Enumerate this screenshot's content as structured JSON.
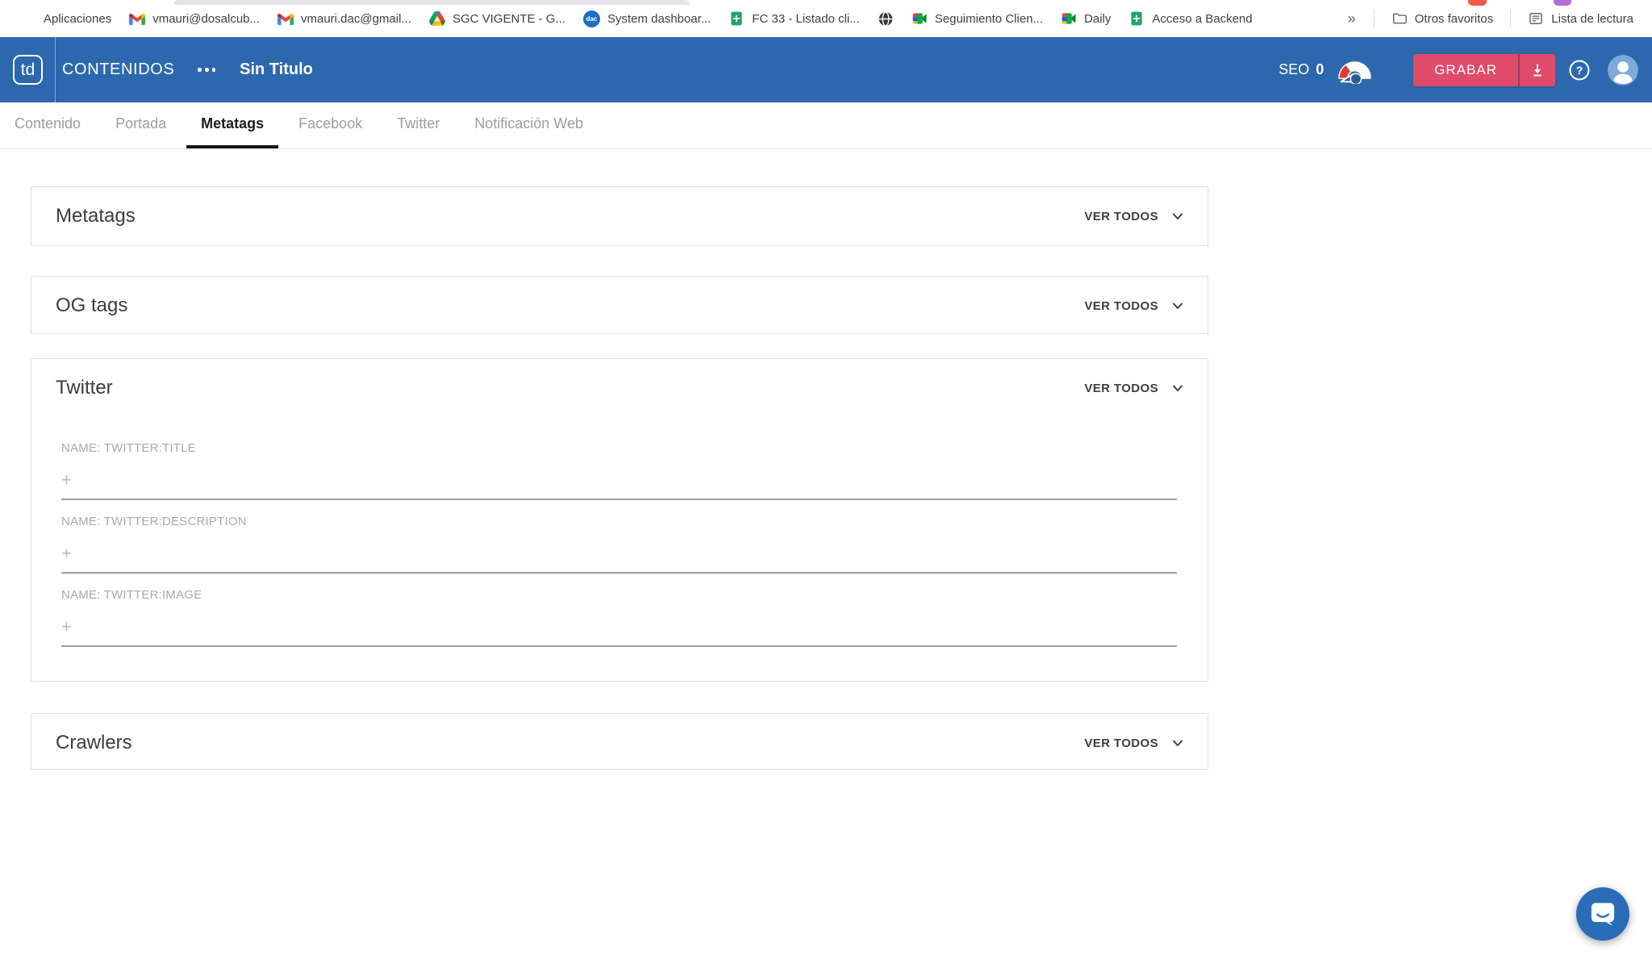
{
  "browser": {
    "bookmarks": [
      {
        "label": "Aplicaciones",
        "icon": "apps-grid"
      },
      {
        "label": "vmauri@dosalcub...",
        "icon": "gmail"
      },
      {
        "label": "vmauri.dac@gmail...",
        "icon": "gmail"
      },
      {
        "label": "SGC VIGENTE - G...",
        "icon": "drive"
      },
      {
        "label": "System dashboar...",
        "icon": "dac"
      },
      {
        "label": "FC 33 - Listado cli...",
        "icon": "sheets"
      },
      {
        "label": "",
        "icon": "globe"
      },
      {
        "label": "Seguimiento Clien...",
        "icon": "meet"
      },
      {
        "label": "Daily",
        "icon": "meet"
      },
      {
        "label": "Acceso a Backend",
        "icon": "sheets"
      }
    ],
    "overflow_chevron": "»",
    "other_favorites": "Otros favoritos",
    "reading_list": "Lista de lectura"
  },
  "app_header": {
    "logo": "td",
    "section": "CONTENIDOS",
    "page_title": "Sin Titulo",
    "seo_label": "SEO",
    "seo_value": "0",
    "save_label": "GRABAR"
  },
  "tabs": [
    {
      "label": "Contenido",
      "active": false
    },
    {
      "label": "Portada",
      "active": false
    },
    {
      "label": "Metatags",
      "active": true
    },
    {
      "label": "Facebook",
      "active": false
    },
    {
      "label": "Twitter",
      "active": false
    },
    {
      "label": "Notificación Web",
      "active": false
    }
  ],
  "sections": [
    {
      "title": "Metatags",
      "action": "VER TODOS",
      "expanded": false
    },
    {
      "title": "OG tags",
      "action": "VER TODOS",
      "expanded": false
    },
    {
      "title": "Twitter",
      "action": "VER TODOS",
      "expanded": true,
      "fields": [
        {
          "label": "NAME: TWITTER:TITLE",
          "add": "+",
          "value": ""
        },
        {
          "label": "NAME: TWITTER:DESCRIPTION",
          "add": "+",
          "value": ""
        },
        {
          "label": "NAME: TWITTER:IMAGE",
          "add": "+",
          "value": ""
        }
      ]
    },
    {
      "title": "Crawlers",
      "action": "VER TODOS",
      "expanded": false
    }
  ],
  "colors": {
    "header_blue": "#2d68ae",
    "accent_pink": "#e04a6b",
    "chat_blue": "#2a6cb8",
    "active_tab_underline": "#161616",
    "google_blue": "#4285F4",
    "google_red": "#EA4335",
    "google_yellow": "#FBBC04",
    "google_green": "#34A853"
  }
}
